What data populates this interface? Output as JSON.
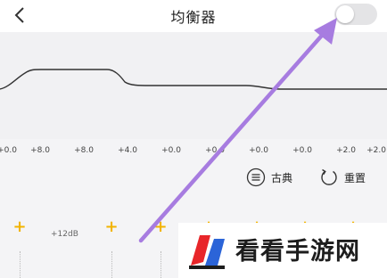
{
  "header": {
    "title": "均衡器",
    "back_icon": "chevron-left-icon",
    "toggle": {
      "state": "off"
    }
  },
  "equalizer": {
    "band_gains": [
      "+0.0",
      "+8.0",
      "+8.0",
      "+4.0",
      "+0.0",
      "+0.0",
      "+0.0",
      "+0.0",
      "+2.0",
      "+2.0"
    ]
  },
  "actions": {
    "preset_label": "古典",
    "preset_icon": "list-circle-icon",
    "reset_label": "重置",
    "reset_icon": "refresh-icon"
  },
  "sliders": {
    "max_label": "+12dB",
    "plus_icon": "plus-icon"
  },
  "watermark": {
    "text": "看看手游网"
  },
  "colors": {
    "accent_plus": "#f2b400",
    "annotation_arrow": "#a77ce0",
    "watermark_red": "#e8262a",
    "watermark_blue": "#2b64d8"
  }
}
